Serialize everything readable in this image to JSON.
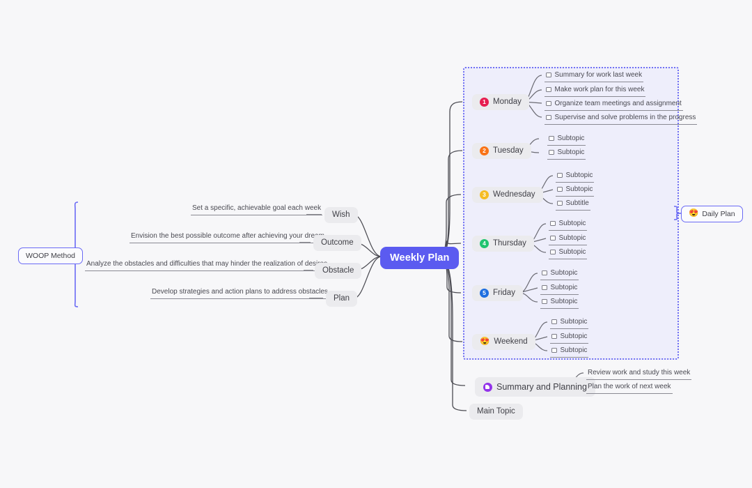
{
  "title": "Weekly Plan Mind Map",
  "root": {
    "label": "Weekly Plan",
    "color": "#5b5bf0"
  },
  "left_branch": {
    "root_label": "WOOP Method",
    "bracket_color": "#6a6af5",
    "items": [
      {
        "label": "Wish",
        "detail": "Set a specific, achievable goal each week"
      },
      {
        "label": "Outcome",
        "detail": "Envision the best possible outcome after achieving your dream"
      },
      {
        "label": "Obstacle",
        "detail": "Analyze the obstacles and difficulties that may hinder the realization of desires"
      },
      {
        "label": "Plan",
        "detail": "Develop strategies and action plans to address obstacles"
      }
    ]
  },
  "right_branch": {
    "group_label": "Daily Plan",
    "group_emoji": "😍",
    "group_border_color": "#6f6ff3",
    "days": [
      {
        "label": "Monday",
        "badge": "1",
        "badge_color": "#e61e50",
        "subtopics": [
          "Summary for work last week",
          "Make work plan for this week",
          "Organize team meetings and assignment",
          "Supervise and solve problems in the progress"
        ]
      },
      {
        "label": "Tuesday",
        "badge": "2",
        "badge_color": "#f97316",
        "subtopics": [
          "Subtopic",
          "Subtopic"
        ]
      },
      {
        "label": "Wednesday",
        "badge": "3",
        "badge_color": "#f5bc24",
        "subtopics": [
          "Subtopic",
          "Subtopic",
          "Subtitle"
        ]
      },
      {
        "label": "Thursday",
        "badge": "4",
        "badge_color": "#20c470",
        "subtopics": [
          "Subtopic",
          "Subtopic",
          "Subtopic"
        ]
      },
      {
        "label": "Friday",
        "badge": "5",
        "badge_color": "#1f6fe0",
        "subtopics": [
          "Subtopic",
          "Subtopic",
          "Subtopic"
        ]
      },
      {
        "label": "Weekend",
        "badge": "😍",
        "badge_color": "",
        "subtopics": [
          "Subtopic",
          "Subtopic",
          "Subtopic"
        ]
      }
    ],
    "summary": {
      "label": "Summary and Planning",
      "icon": "flag-circle-icon",
      "icon_color": "#9333ea",
      "subtopics": [
        "Review work and study this week",
        "Plan the work of next week"
      ]
    },
    "main_topic": {
      "label": "Main Topic"
    }
  }
}
